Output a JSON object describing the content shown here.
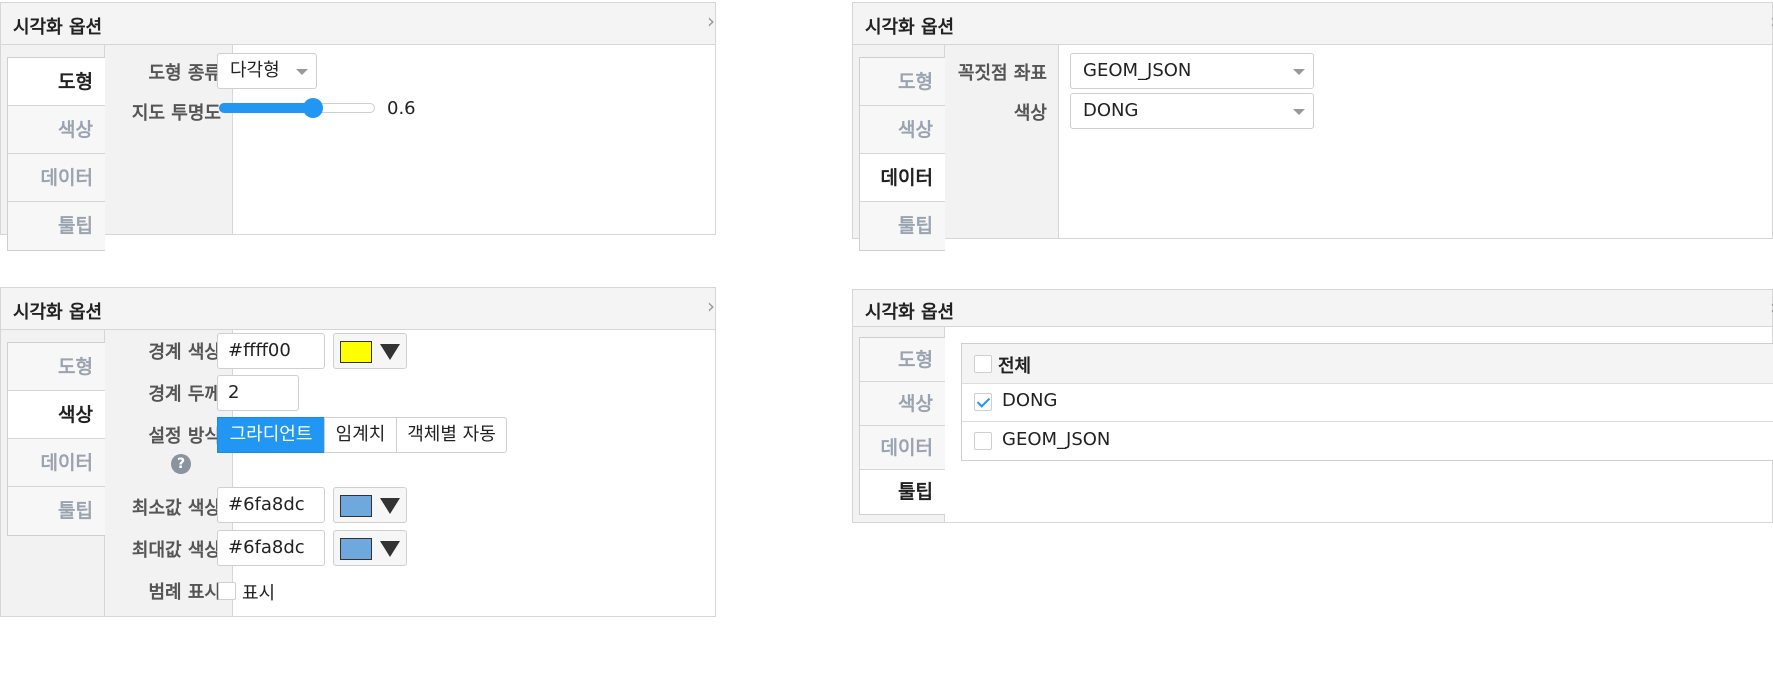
{
  "panel_title": "시각화 옵션",
  "chevron": "›",
  "tabs": [
    "도형",
    "색상",
    "데이터",
    "툴팁"
  ],
  "panel1": {
    "shape_type_label": "도형 종류",
    "shape_type_value": "다각형",
    "opacity_label": "지도 투명도",
    "opacity_value": "0.6",
    "opacity_fraction": 0.6
  },
  "panel2": {
    "vertex_label": "꼭짓점 좌표",
    "vertex_value": "GEOM_JSON",
    "color_label": "색상",
    "color_value": "DONG"
  },
  "panel3": {
    "border_color_label": "경계 색상",
    "border_color_value": "#ffff00",
    "border_width_label": "경계 두께",
    "border_width_value": "2",
    "method_label": "설정 방식",
    "methods": [
      "그라디언트",
      "임계치",
      "객체별 자동"
    ],
    "help_glyph": "?",
    "min_color_label": "최소값 색상",
    "min_color_value": "#6fa8dc",
    "max_color_label": "최대값 색상",
    "max_color_value": "#6fa8dc",
    "legend_label": "범례 표시",
    "legend_checkbox_label": "표시"
  },
  "panel4": {
    "all_label": "전체",
    "items": [
      {
        "label": "DONG",
        "checked": true
      },
      {
        "label": "GEOM_JSON",
        "checked": false
      }
    ]
  },
  "colors": {
    "accent": "#2196f3",
    "swatch_yellow": "#ffff00",
    "swatch_blue": "#6fa8dc"
  },
  "icons": [
    "chevron-right-icon",
    "dropdown-caret-icon",
    "help-icon",
    "check-icon"
  ]
}
